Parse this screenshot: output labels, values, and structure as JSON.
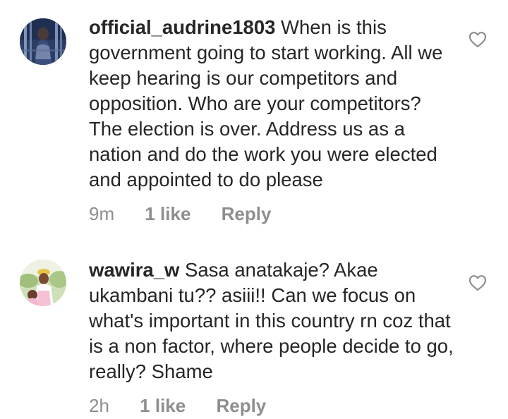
{
  "comments": [
    {
      "username": "official_audrine1803",
      "text": " When is this government going to start working.  All we keep hearing is our competitors and opposition.  Who are your competitors? The election is over. Address us as a nation and do the work you were elected and appointed to do please",
      "time": "9m",
      "likes": "1 like",
      "reply": "Reply",
      "like_icon": "heart-outline-icon"
    },
    {
      "username": "wawira_w",
      "text": " Sasa anatakaje? Akae ukambani tu?? asiii!! Can we focus on what's important in this country rn coz that is a non factor, where people decide to go, really? Shame",
      "time": "2h",
      "likes": "1 like",
      "reply": "Reply",
      "like_icon": "heart-outline-icon"
    }
  ],
  "colors": {
    "text": "#262626",
    "secondary": "#8e8e8e",
    "background": "#ffffff"
  }
}
